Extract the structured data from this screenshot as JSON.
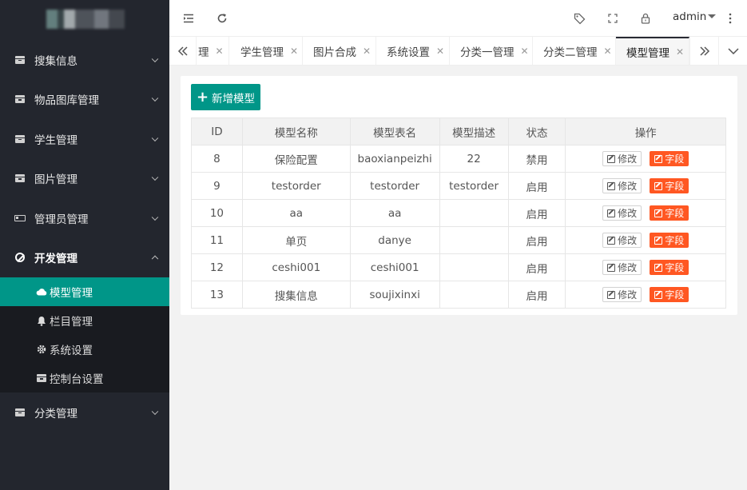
{
  "sidebar": {
    "menu": [
      {
        "label": "搜集信息",
        "icon": "box-icon"
      },
      {
        "label": "物品图库管理",
        "icon": "box-icon"
      },
      {
        "label": "学生管理",
        "icon": "box-icon"
      },
      {
        "label": "图片管理",
        "icon": "box-icon"
      },
      {
        "label": "管理员管理",
        "icon": "battery-icon"
      },
      {
        "label": "开发管理",
        "icon": "ban-icon"
      }
    ],
    "submenu": [
      {
        "label": "模型管理",
        "icon": "cloud-icon"
      },
      {
        "label": "栏目管理",
        "icon": "bell-icon"
      },
      {
        "label": "系统设置",
        "icon": "gear-icon"
      },
      {
        "label": "控制台设置",
        "icon": "box-icon"
      }
    ],
    "last_menu": {
      "label": "分类管理",
      "icon": "box-icon"
    }
  },
  "topbar": {
    "user": "admin"
  },
  "tabs": [
    {
      "label": "理"
    },
    {
      "label": "学生管理"
    },
    {
      "label": "图片合成"
    },
    {
      "label": "系统设置"
    },
    {
      "label": "分类一管理"
    },
    {
      "label": "分类二管理"
    },
    {
      "label": "模型管理"
    }
  ],
  "main": {
    "add_button": "新增模型",
    "table": {
      "headers": [
        "ID",
        "模型名称",
        "模型表名",
        "模型描述",
        "状态",
        "操作"
      ],
      "rows": [
        {
          "id": "8",
          "name": "保险配置",
          "table": "baoxianpeizhi",
          "desc": "22",
          "status": "禁用"
        },
        {
          "id": "9",
          "name": "testorder",
          "table": "testorder",
          "desc": "testorder",
          "status": "启用"
        },
        {
          "id": "10",
          "name": "aa",
          "table": "aa",
          "desc": "",
          "status": "启用"
        },
        {
          "id": "11",
          "name": "单页",
          "table": "danye",
          "desc": "",
          "status": "启用"
        },
        {
          "id": "12",
          "name": "ceshi001",
          "table": "ceshi001",
          "desc": "",
          "status": "启用"
        },
        {
          "id": "13",
          "name": "搜集信息",
          "table": "soujixinxi",
          "desc": "",
          "status": "启用"
        }
      ],
      "edit_label": "修改",
      "field_label": "字段"
    }
  },
  "colors": {
    "accent": "#009688",
    "danger": "#ff5722",
    "sidebar": "#23262e"
  }
}
